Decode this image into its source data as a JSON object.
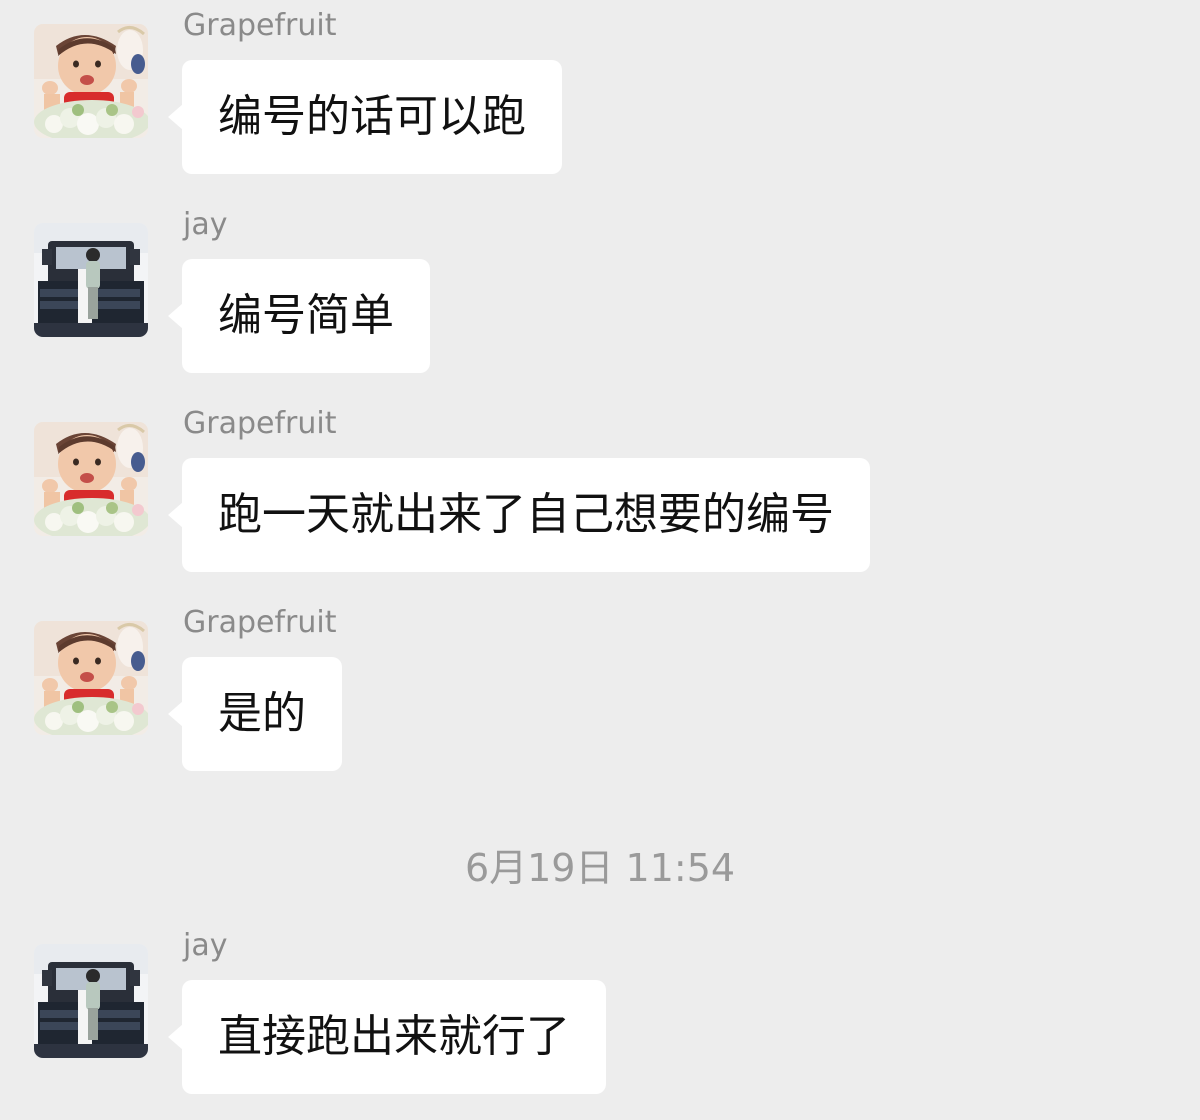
{
  "messages": [
    {
      "sender": "Grapefruit",
      "text": "编号的话可以跑",
      "avatar": "baby-photo-avatar"
    },
    {
      "sender": "jay",
      "text": "编号简单",
      "avatar": "truck-photo-avatar"
    },
    {
      "sender": "Grapefruit",
      "text": "跑一天就出来了自己想要的编号",
      "avatar": "baby-photo-avatar"
    },
    {
      "sender": "Grapefruit",
      "text": "是的",
      "avatar": "baby-photo-avatar"
    },
    {
      "sender": "jay",
      "text": "直接跑出来就行了",
      "avatar": "truck-photo-avatar"
    }
  ],
  "timestamp": "6月19日 11:54",
  "colors": {
    "background": "#ededed",
    "bubble": "#ffffff",
    "sender_name": "#8a8a8a",
    "timestamp": "#9a9a9a"
  }
}
